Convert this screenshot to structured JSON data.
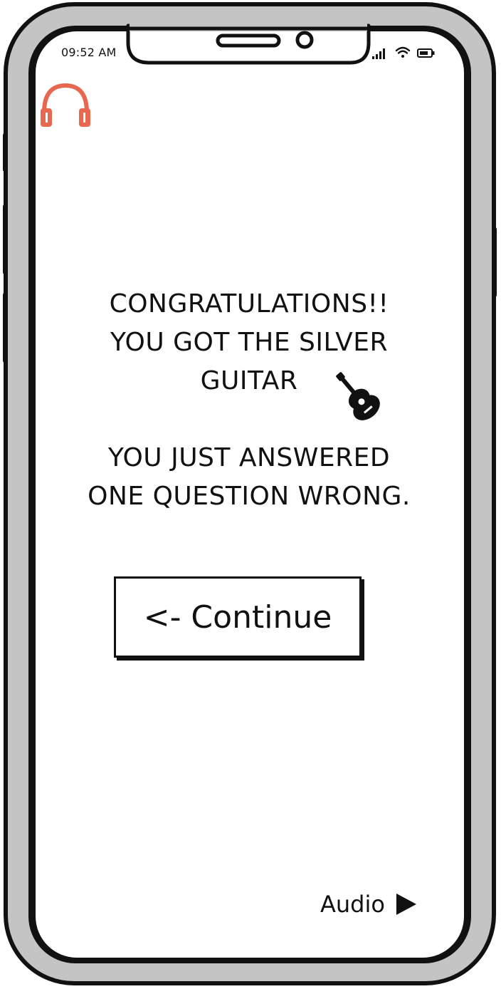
{
  "status_bar": {
    "time": "09:52 AM",
    "icons": [
      "signal-icon",
      "wifi-icon",
      "battery-icon"
    ]
  },
  "header": {
    "icon": "headphones-icon",
    "icon_color": "#e8674f"
  },
  "result": {
    "lines": [
      "CONGRATULATIONS!!",
      "YOU GOT THE SILVER",
      "GUITAR"
    ],
    "detail_lines": [
      "YOU JUST ANSWERED",
      "ONE QUESTION WRONG."
    ],
    "award_icon": "guitar-icon"
  },
  "continue_button": {
    "label": "<- Continue"
  },
  "audio_control": {
    "label": "Audio",
    "icon": "play-icon"
  },
  "colors": {
    "frame_gray": "#c4c4c4",
    "ink": "#111111",
    "screen": "#ffffff"
  }
}
